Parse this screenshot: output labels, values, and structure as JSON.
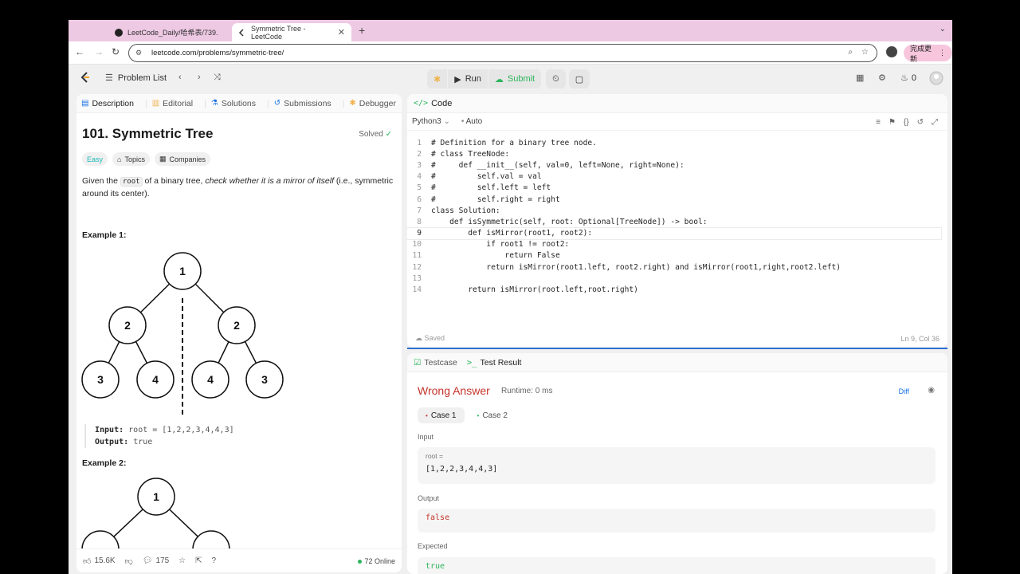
{
  "browser": {
    "tabs": [
      {
        "title": "LeetCode_Daily/哈希表/739."
      },
      {
        "title": "Symmetric Tree - LeetCode"
      }
    ],
    "url": "leetcode.com/problems/symmetric-tree/",
    "update_label": "完成更新"
  },
  "header": {
    "problem_list": "Problem List",
    "run": "Run",
    "submit": "Submit",
    "streak": "0"
  },
  "left": {
    "tabs": [
      "Description",
      "Editorial",
      "Solutions",
      "Submissions",
      "Debugger"
    ],
    "title": "101. Symmetric Tree",
    "solved": "Solved",
    "tags": [
      "Easy",
      "Topics",
      "Companies"
    ],
    "desc_pre": "Given the ",
    "desc_code": "root",
    "desc_mid": " of a binary tree, ",
    "desc_em": "check whether it is a mirror of itself",
    "desc_post": " (i.e., symmetric around its center).",
    "example1": "Example 1:",
    "example2": "Example 2:",
    "tree1": [
      "1",
      "2",
      "2",
      "3",
      "4",
      "4",
      "3"
    ],
    "tree2_root": "1",
    "input_label": "Input:",
    "input_value": "root = [1,2,2,3,4,4,3]",
    "output_label": "Output:",
    "output_value": "true",
    "likes": "15.6K",
    "comments": "175",
    "online": "72 Online"
  },
  "code": {
    "title": "Code",
    "language": "Python3",
    "mode": "Auto",
    "saved": "Saved",
    "cursor": "Ln 9, Col 36",
    "lines": [
      "# Definition for a binary tree node.",
      "# class TreeNode:",
      "#     def __init__(self, val=0, left=None, right=None):",
      "#         self.val = val",
      "#         self.left = left",
      "#         self.right = right",
      "class Solution:",
      "    def isSymmetric(self, root: Optional[TreeNode]) -> bool:",
      "        def isMirror(root1, root2):",
      "            if root1 != root2:",
      "                return False",
      "            return isMirror(root1.left, root2.right) and isMirror(root1,right,root2.left)",
      "",
      "        return isMirror(root.left,root.right)"
    ]
  },
  "result": {
    "tabs": [
      "Testcase",
      "Test Result"
    ],
    "verdict": "Wrong Answer",
    "runtime": "Runtime: 0 ms",
    "diff": "Diff",
    "cases": [
      "Case 1",
      "Case 2"
    ],
    "input_label": "Input",
    "input_var": "root =",
    "input_value": "[1,2,2,3,4,4,3]",
    "output_label": "Output",
    "output_value": "false",
    "expected_label": "Expected",
    "expected_value": "true"
  },
  "colors": {
    "accent": "#2f6ecf",
    "wrong": "#c3342b",
    "success": "#2db55d",
    "easy": "#1cb8b8"
  }
}
